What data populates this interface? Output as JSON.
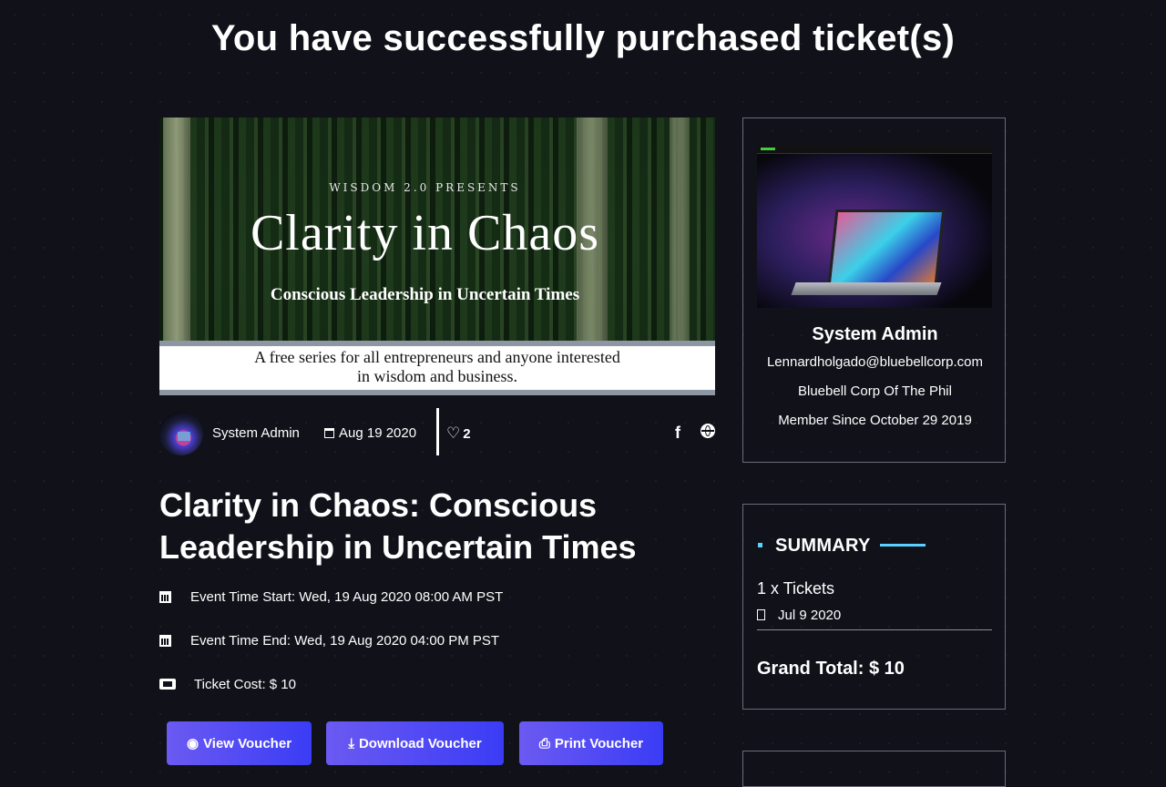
{
  "page": {
    "title": "You have successfully purchased ticket(s)"
  },
  "banner": {
    "presents": "WISDOM 2.0 PRESENTS",
    "title": "Clarity in Chaos",
    "subtitle": "Conscious Leadership in Uncertain Times",
    "tagline_line1": "A free series for all entrepreneurs and anyone interested",
    "tagline_line2": "in wisdom and business."
  },
  "meta": {
    "author": "System Admin",
    "date": "Aug 19 2020",
    "likes": "2",
    "icons": [
      "calendar-icon",
      "heart-icon",
      "facebook-icon",
      "globe-icon"
    ]
  },
  "event": {
    "title_line1": "Clarity in Chaos: Conscious",
    "title_line2": "Leadership in Uncertain Times",
    "time_start": "Event Time Start: Wed, 19 Aug 2020 08:00 AM PST",
    "time_end": "Event Time End: Wed, 19 Aug 2020 04:00 PM PST",
    "ticket_cost": "Ticket Cost: $ 10"
  },
  "buttons": {
    "view": "View Voucher",
    "download": "Download Voucher",
    "print": "Print Voucher"
  },
  "profile": {
    "name": "System Admin",
    "email": "Lennardholgado@bluebellcorp.com",
    "company": "Bluebell Corp Of The Phil",
    "member_since": "Member Since October 29 2019"
  },
  "summary": {
    "title": "SUMMARY",
    "item": "1 x Tickets",
    "date": "Jul 9 2020",
    "grand_total": "Grand Total: $ 10"
  },
  "colors": {
    "background": "#11111a",
    "button_gradient_start": "#6b5af2",
    "button_gradient_end": "#3a3cf5",
    "accent": "#5ad1ff",
    "card_border": "#6b6b78"
  }
}
